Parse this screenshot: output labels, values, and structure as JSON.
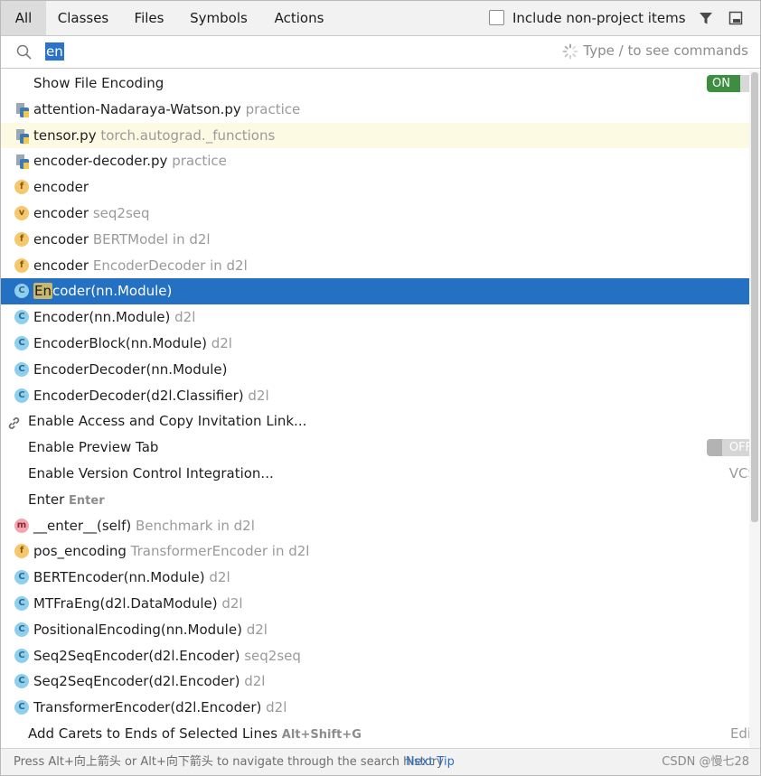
{
  "tabs": [
    {
      "label": "All",
      "active": true
    },
    {
      "label": "Classes"
    },
    {
      "label": "Files"
    },
    {
      "label": "Symbols"
    },
    {
      "label": "Actions"
    }
  ],
  "include_non_project": {
    "label": "Include non-project items",
    "checked": false
  },
  "search": {
    "query": "en",
    "hint": "Type / to see commands"
  },
  "results": [
    {
      "kind": "action",
      "name": "Show File Encoding",
      "toggle": "ON"
    },
    {
      "kind": "file",
      "icon": "python-file-icon",
      "name": "attention-Nadaraya-Watson.py",
      "location": "practice"
    },
    {
      "kind": "file",
      "icon": "python-file-icon",
      "name": "tensor.py",
      "location": "torch.autograd._functions",
      "highlighted": true
    },
    {
      "kind": "file",
      "icon": "python-file-icon",
      "name": "encoder-decoder.py",
      "location": "practice"
    },
    {
      "kind": "symbol",
      "icon": "function-icon",
      "badge": "f",
      "name": "encoder",
      "location": ""
    },
    {
      "kind": "symbol",
      "icon": "variable-icon",
      "badge": "v",
      "name": "encoder",
      "location": "seq2seq"
    },
    {
      "kind": "symbol",
      "icon": "function-icon",
      "badge": "f",
      "name": "encoder",
      "location": "BERTModel in d2l"
    },
    {
      "kind": "symbol",
      "icon": "function-icon",
      "badge": "f",
      "name": "encoder",
      "location": "EncoderDecoder in d2l"
    },
    {
      "kind": "symbol",
      "icon": "class-icon",
      "badge": "C",
      "name": "Encoder(nn.Module)",
      "location": "",
      "selected": true,
      "match": "En",
      "rest": "coder(nn.Module)"
    },
    {
      "kind": "symbol",
      "icon": "class-icon",
      "badge": "C",
      "name": "Encoder(nn.Module)",
      "location": "d2l"
    },
    {
      "kind": "symbol",
      "icon": "class-icon",
      "badge": "C",
      "name": "EncoderBlock(nn.Module)",
      "location": "d2l"
    },
    {
      "kind": "symbol",
      "icon": "class-icon",
      "badge": "C",
      "name": "EncoderDecoder(nn.Module)",
      "location": ""
    },
    {
      "kind": "symbol",
      "icon": "class-icon",
      "badge": "C",
      "name": "EncoderDecoder(d2l.Classifier)",
      "location": "d2l"
    },
    {
      "kind": "action",
      "icon": "link-icon",
      "name": "Enable Access and Copy Invitation Link..."
    },
    {
      "kind": "action",
      "name": "Enable Preview Tab",
      "toggle": "OFF"
    },
    {
      "kind": "action",
      "name": "Enable Version Control Integration...",
      "tag": "VCS"
    },
    {
      "kind": "action",
      "name": "Enter",
      "shortcut": "Enter"
    },
    {
      "kind": "symbol",
      "icon": "method-icon",
      "badge": "m",
      "name": "__enter__(self)",
      "location": "Benchmark in d2l"
    },
    {
      "kind": "symbol",
      "icon": "function-icon",
      "badge": "f",
      "name": "pos_encoding",
      "location": "TransformerEncoder in d2l"
    },
    {
      "kind": "symbol",
      "icon": "class-icon",
      "badge": "C",
      "name": "BERTEncoder(nn.Module)",
      "location": "d2l"
    },
    {
      "kind": "symbol",
      "icon": "class-icon",
      "badge": "C",
      "name": "MTFraEng(d2l.DataModule)",
      "location": "d2l"
    },
    {
      "kind": "symbol",
      "icon": "class-icon",
      "badge": "C",
      "name": "PositionalEncoding(nn.Module)",
      "location": "d2l"
    },
    {
      "kind": "symbol",
      "icon": "class-icon",
      "badge": "C",
      "name": "Seq2SeqEncoder(d2l.Encoder)",
      "location": "seq2seq"
    },
    {
      "kind": "symbol",
      "icon": "class-icon",
      "badge": "C",
      "name": "Seq2SeqEncoder(d2l.Encoder)",
      "location": "d2l"
    },
    {
      "kind": "symbol",
      "icon": "class-icon",
      "badge": "C",
      "name": "TransformerEncoder(d2l.Encoder)",
      "location": "d2l"
    },
    {
      "kind": "action",
      "name": "Add Carets to Ends of Selected Lines",
      "shortcut": "Alt+Shift+G",
      "tag": "Edit"
    }
  ],
  "footer": {
    "tip": "Press Alt+向上箭头 or Alt+向下箭头 to navigate through the search history",
    "next_tip": "Next Tip",
    "watermark": "CSDN @慢七28"
  },
  "colors": {
    "selection": "#2470c2",
    "highlight_row": "#fcfae3",
    "toggle_on": "#3e8e41",
    "link": "#2b6ec8"
  }
}
